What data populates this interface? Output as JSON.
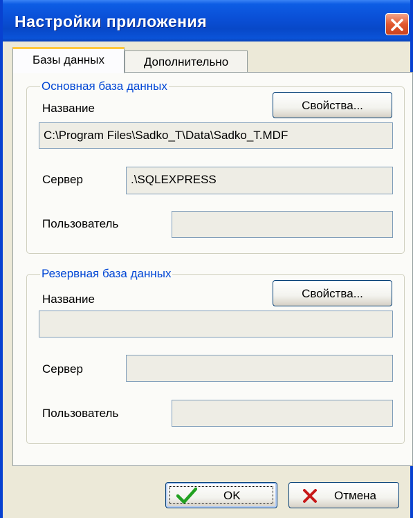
{
  "window": {
    "title": "Настройки приложения"
  },
  "tabs": [
    {
      "label": "Базы данных",
      "active": true
    },
    {
      "label": "Дополнительно",
      "active": false
    }
  ],
  "primary_db": {
    "legend": "Основная база данных",
    "name_label": "Название",
    "properties_button": "Свойства...",
    "name_value": "C:\\Program Files\\Sadko_T\\Data\\Sadko_T.MDF",
    "server_label": "Сервер",
    "server_value": ".\\SQLEXPRESS",
    "user_label": "Пользователь",
    "user_value": ""
  },
  "backup_db": {
    "legend": "Резервная база данных",
    "name_label": "Название",
    "properties_button": "Свойства...",
    "name_value": "",
    "server_label": "Сервер",
    "server_value": "",
    "user_label": "Пользователь",
    "user_value": ""
  },
  "buttons": {
    "ok": "OK",
    "cancel": "Отмена"
  },
  "icons": {
    "close": "close-icon",
    "ok": "checkmark-icon",
    "cancel": "x-icon"
  },
  "colors": {
    "titlebar": "#0A4FD6",
    "legend_text": "#0046D5",
    "dialog_bg": "#ECE9D8",
    "active_tab_accent": "#FFC83C"
  }
}
